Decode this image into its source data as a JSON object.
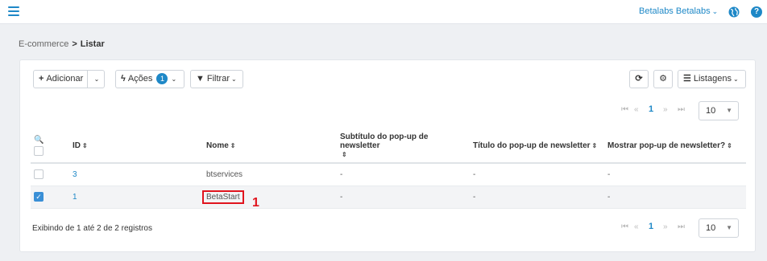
{
  "topbar": {
    "user_label": "Betalabs Betalabs"
  },
  "breadcrumb": {
    "parent": "E-commerce",
    "separator": ">",
    "current": "Listar"
  },
  "toolbar": {
    "add_label": "Adicionar",
    "actions_label": "Ações",
    "actions_badge": "1",
    "filter_label": "Filtrar",
    "listings_label": "Listagens"
  },
  "pagination": {
    "current_page": "1",
    "page_size": "10"
  },
  "table": {
    "columns": [
      "ID",
      "Nome",
      "Subtítulo do pop-up de newsletter",
      "Título do pop-up de newsletter",
      "Mostrar pop-up de newsletter?"
    ],
    "rows": [
      {
        "id": "3",
        "name": "btservices",
        "subtitle": "-",
        "title": "-",
        "show": "-",
        "checked": false
      },
      {
        "id": "1",
        "name": "BetaStart",
        "subtitle": "-",
        "title": "-",
        "show": "-",
        "checked": true
      }
    ]
  },
  "footer": {
    "info": "Exibindo de 1 até 2 de 2 registros"
  },
  "annotation": {
    "marker": "1",
    "color": "#e0141e"
  },
  "colors": {
    "accent": "#1e88c7",
    "checkbox_checked": "#3a8fd6"
  }
}
